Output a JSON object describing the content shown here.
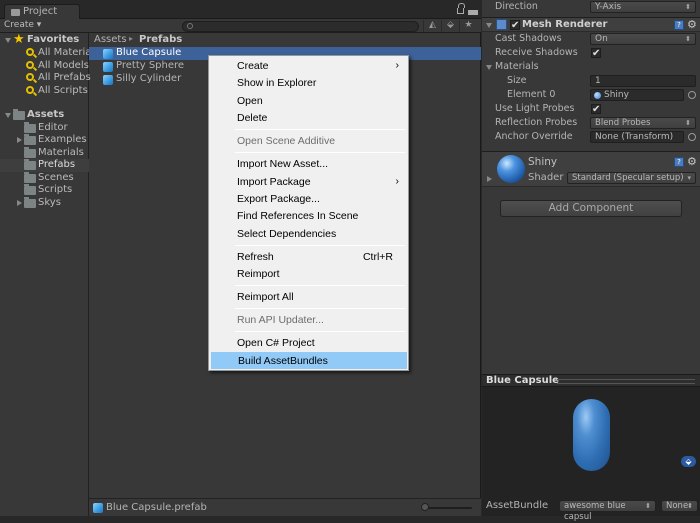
{
  "project": {
    "tab_label": "Project",
    "create_label": "Create ▾",
    "favorites": {
      "label": "Favorites",
      "items": [
        "All Material",
        "All Models",
        "All Prefabs",
        "All Scripts"
      ]
    },
    "assets": {
      "label": "Assets",
      "folders": [
        {
          "label": "Editor",
          "expandable": false
        },
        {
          "label": "Examples",
          "expandable": true
        },
        {
          "label": "Materials",
          "expandable": false
        },
        {
          "label": "Prefabs",
          "expandable": false,
          "selected": true
        },
        {
          "label": "Scenes",
          "expandable": false
        },
        {
          "label": "Scripts",
          "expandable": false
        },
        {
          "label": "Skys",
          "expandable": true
        }
      ]
    },
    "breadcrumb": {
      "root": "Assets",
      "sep": "▸",
      "current": "Prefabs"
    },
    "items": [
      {
        "label": "Blue Capsule",
        "selected": true
      },
      {
        "label": "Pretty Sphere",
        "selected": false
      },
      {
        "label": "Silly Cylinder",
        "selected": false
      }
    ],
    "footer_path": "Blue Capsule.prefab"
  },
  "context_menu": {
    "items": [
      {
        "label": "Create",
        "submenu": true
      },
      {
        "label": "Show in Explorer"
      },
      {
        "label": "Open"
      },
      {
        "label": "Delete"
      },
      {
        "separator": true
      },
      {
        "label": "Open Scene Additive",
        "disabled": true
      },
      {
        "separator": true
      },
      {
        "label": "Import New Asset..."
      },
      {
        "label": "Import Package",
        "submenu": true
      },
      {
        "label": "Export Package..."
      },
      {
        "label": "Find References In Scene"
      },
      {
        "label": "Select Dependencies"
      },
      {
        "separator": true
      },
      {
        "label": "Refresh",
        "shortcut": "Ctrl+R"
      },
      {
        "label": "Reimport"
      },
      {
        "separator": true
      },
      {
        "label": "Reimport All"
      },
      {
        "separator": true
      },
      {
        "label": "Run API Updater...",
        "disabled": true
      },
      {
        "separator": true
      },
      {
        "label": "Open C# Project"
      },
      {
        "label": "Build AssetBundles",
        "highlighted": true
      }
    ]
  },
  "inspector": {
    "direction": {
      "label": "Direction",
      "value": "Y-Axis"
    },
    "mesh_renderer": {
      "title": "Mesh Renderer",
      "enabled": true,
      "cast_shadows": {
        "label": "Cast Shadows",
        "value": "On"
      },
      "receive_shadows": {
        "label": "Receive Shadows",
        "checked": true
      },
      "materials": {
        "label": "Materials",
        "size_label": "Size",
        "size": "1",
        "element_label": "Element 0",
        "element_value": "Shiny"
      },
      "use_light_probes": {
        "label": "Use Light Probes",
        "checked": true
      },
      "reflection_probes": {
        "label": "Reflection Probes",
        "value": "Blend Probes"
      },
      "anchor_override": {
        "label": "Anchor Override",
        "value": "None (Transform)"
      }
    },
    "material": {
      "name": "Shiny",
      "shader_label": "Shader",
      "shader_value": "Standard (Specular setup)"
    },
    "add_component_label": "Add Component",
    "preview": {
      "title": "Blue Capsule",
      "assetbundle_label": "AssetBundle",
      "assetbundle_name": "awesome blue capsul",
      "assetbundle_variant": "None"
    }
  },
  "colors": {
    "selection": "#3d6199",
    "menu_highlight": "#91c9f7",
    "panel": "#383838"
  }
}
